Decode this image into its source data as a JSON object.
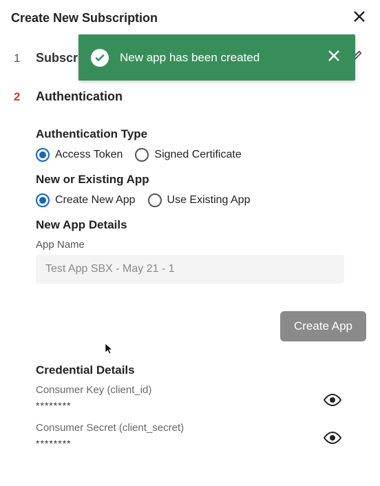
{
  "dialog": {
    "title": "Create New Subscription"
  },
  "toast": {
    "message": "New app has been created"
  },
  "steps": {
    "one": {
      "number": "1",
      "label": "Subscription Name"
    },
    "two": {
      "number": "2",
      "label": "Authentication"
    }
  },
  "sections": {
    "auth_type_title": "Authentication Type",
    "app_mode_title": "New or Existing App",
    "new_app_title": "New App Details",
    "cred_title": "Credential Details"
  },
  "radios": {
    "access_token": "Access Token",
    "signed_cert": "Signed Certificate",
    "create_new": "Create New App",
    "use_existing": "Use Existing App"
  },
  "app_name": {
    "label": "App Name",
    "value": "Test App SBX - May 21 - 1"
  },
  "buttons": {
    "create_app": "Create App"
  },
  "credentials": {
    "key_label": "Consumer Key (client_id)",
    "key_mask": "********",
    "secret_label": "Consumer Secret (client_secret)",
    "secret_mask": "********"
  }
}
